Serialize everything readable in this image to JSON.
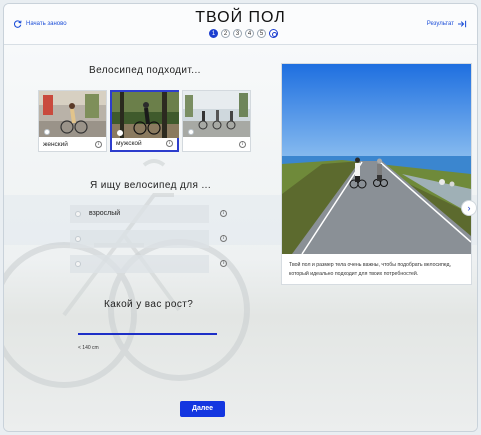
{
  "header": {
    "restart_label": "Начать заново",
    "title": "ТВОЙ ПОЛ",
    "steps": [
      "1",
      "2",
      "3",
      "4",
      "5",
      ""
    ],
    "active_step": 1,
    "result_label": "Результат"
  },
  "gender": {
    "heading": "Велосипед подходит...",
    "tiles": [
      {
        "label": "женский",
        "selected": false
      },
      {
        "label": "мужской",
        "selected": true
      },
      {
        "label": "",
        "selected": false
      }
    ]
  },
  "purpose": {
    "heading": "Я ищу велосипед для ...",
    "options": [
      {
        "label": "взрослый"
      },
      {
        "label": ""
      },
      {
        "label": ""
      }
    ]
  },
  "height": {
    "heading": "Какой у вас рост?",
    "min_label": "< 140 cm",
    "value_fraction": 0.0
  },
  "info_card": {
    "caption": "Твой пол и размер тела очень важны, чтобы подобрать велосипед, который идеально подходит для твоих потребностей."
  },
  "next_label": "Далее",
  "colors": {
    "accent": "#1d3fd0",
    "button": "#1336e0"
  }
}
